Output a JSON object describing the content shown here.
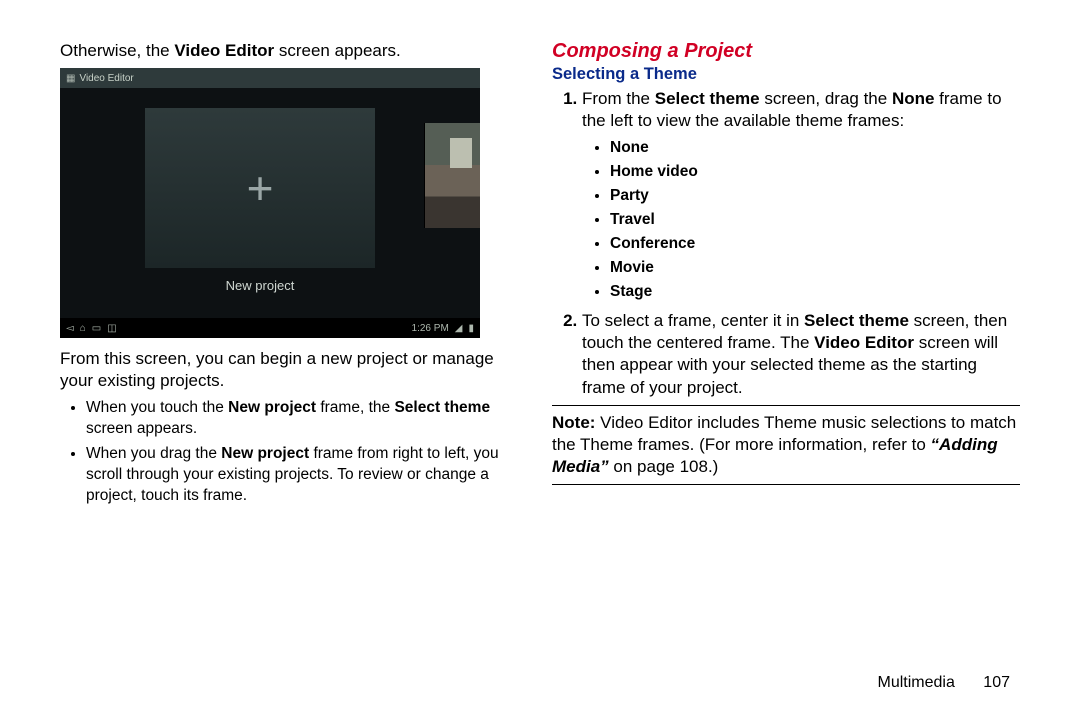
{
  "left": {
    "intro_pre": "Otherwise, the ",
    "intro_bold": "Video Editor",
    "intro_post": " screen appears.",
    "screenshot": {
      "title": "Video Editor",
      "new_project_label": "New project",
      "time": "1:26 PM"
    },
    "after_img": "From this screen, you can begin a new project or manage your existing projects.",
    "bullets": {
      "b1_pre": "When you touch the ",
      "b1_bold1": "New project",
      "b1_mid": " frame, the ",
      "b1_bold2": "Select theme",
      "b1_post": " screen appears.",
      "b2_pre": "When you drag the ",
      "b2_bold": "New project",
      "b2_post": " frame from right to left, you scroll through your existing projects. To review or change a project, touch its frame."
    }
  },
  "right": {
    "h1": "Composing a Project",
    "h2": "Selecting a Theme",
    "step1_pre": "From the ",
    "step1_b1": "Select theme",
    "step1_mid": " screen, drag the ",
    "step1_b2": "None",
    "step1_post": " frame to the left to view the available theme frames:",
    "themes": [
      "None",
      "Home video",
      "Party",
      "Travel",
      "Conference",
      "Movie",
      "Stage"
    ],
    "step2_pre": "To select a frame, center it in ",
    "step2_b1": "Select theme",
    "step2_mid": " screen, then touch the centered frame. The ",
    "step2_b2": "Video Editor",
    "step2_post": " screen will then appear with your selected theme as the starting frame of your project.",
    "note_label": "Note:",
    "note_body": " Video Editor includes Theme music selections to match the Theme frames. (For more information, refer to ",
    "note_ref": "“Adding Media”",
    "note_tail": " on page 108.)"
  },
  "footer": {
    "section": "Multimedia",
    "page": "107"
  }
}
